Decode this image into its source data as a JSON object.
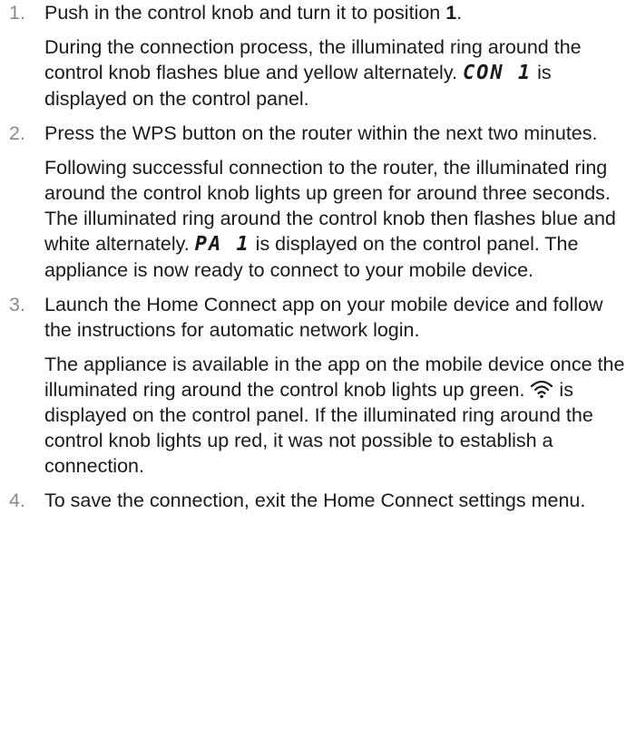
{
  "steps": [
    {
      "number": "1.",
      "line1_pre": "Push in the control knob and turn it to position ",
      "line1_bold": "1",
      "line1_post": ".",
      "detail_pre": "During the connection process, the illuminated ring around the control knob flashes blue and yellow alternately. ",
      "display_code": "CON 1",
      "detail_post": " is displayed on the control panel."
    },
    {
      "number": "2.",
      "line1": "Press the WPS button on the router within the next two minutes.",
      "detail_pre": "Following successful connection to the router, the illuminated ring around the control knob lights up green for around three seconds. The illuminated ring around the control knob then flashes blue and white alternately. ",
      "display_code": "PA 1",
      "detail_post": " is displayed on the control panel. The appliance is now ready to connect to your mobile device."
    },
    {
      "number": "3.",
      "line1": "Launch the Home Connect app on your mobile device and follow the instructions for automatic network login.",
      "detail_pre": "The appliance is available in the app on the mobile device once the illuminated ring around the control knob lights up green. ",
      "icon": "wifi-icon",
      "detail_post": " is displayed on the control panel. If the illuminated ring around the control knob lights up red, it was not possible to establish a connection."
    },
    {
      "number": "4.",
      "line1": "To save the connection, exit the Home Connect settings menu."
    }
  ],
  "colors": {
    "text": "#1a1a1a",
    "step_number": "#8a8a8a"
  }
}
